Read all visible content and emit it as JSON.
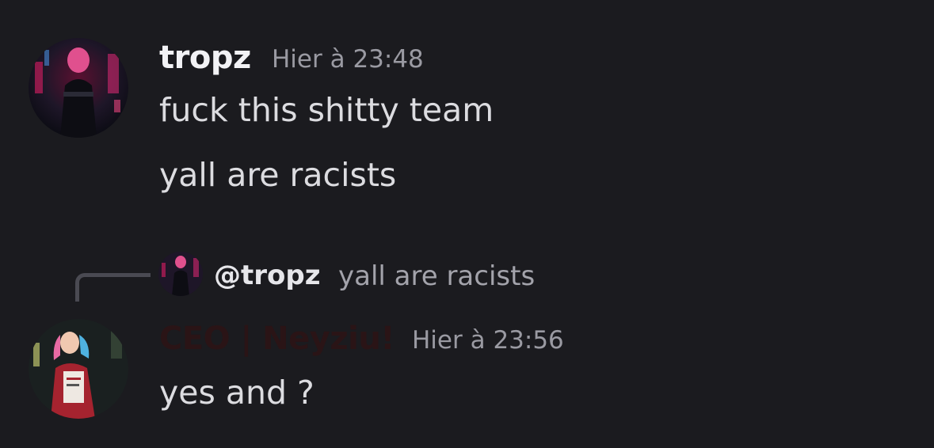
{
  "messages": [
    {
      "author": "tropz",
      "timestamp": "Hier à 23:48",
      "lines": [
        "fuck this shitty team",
        "yall are racists"
      ]
    },
    {
      "reply": {
        "mention": "@tropz",
        "text": "yall are racists"
      },
      "author": "CEO | Neyziu!",
      "author_color": "#2a1416",
      "timestamp": "Hier à 23:56",
      "lines": [
        "yes and ?"
      ]
    }
  ],
  "colors": {
    "background": "#1b1b1f",
    "username_default": "#f2f2f5",
    "timestamp": "#9a9aa2",
    "message_text": "#dcdce0"
  }
}
